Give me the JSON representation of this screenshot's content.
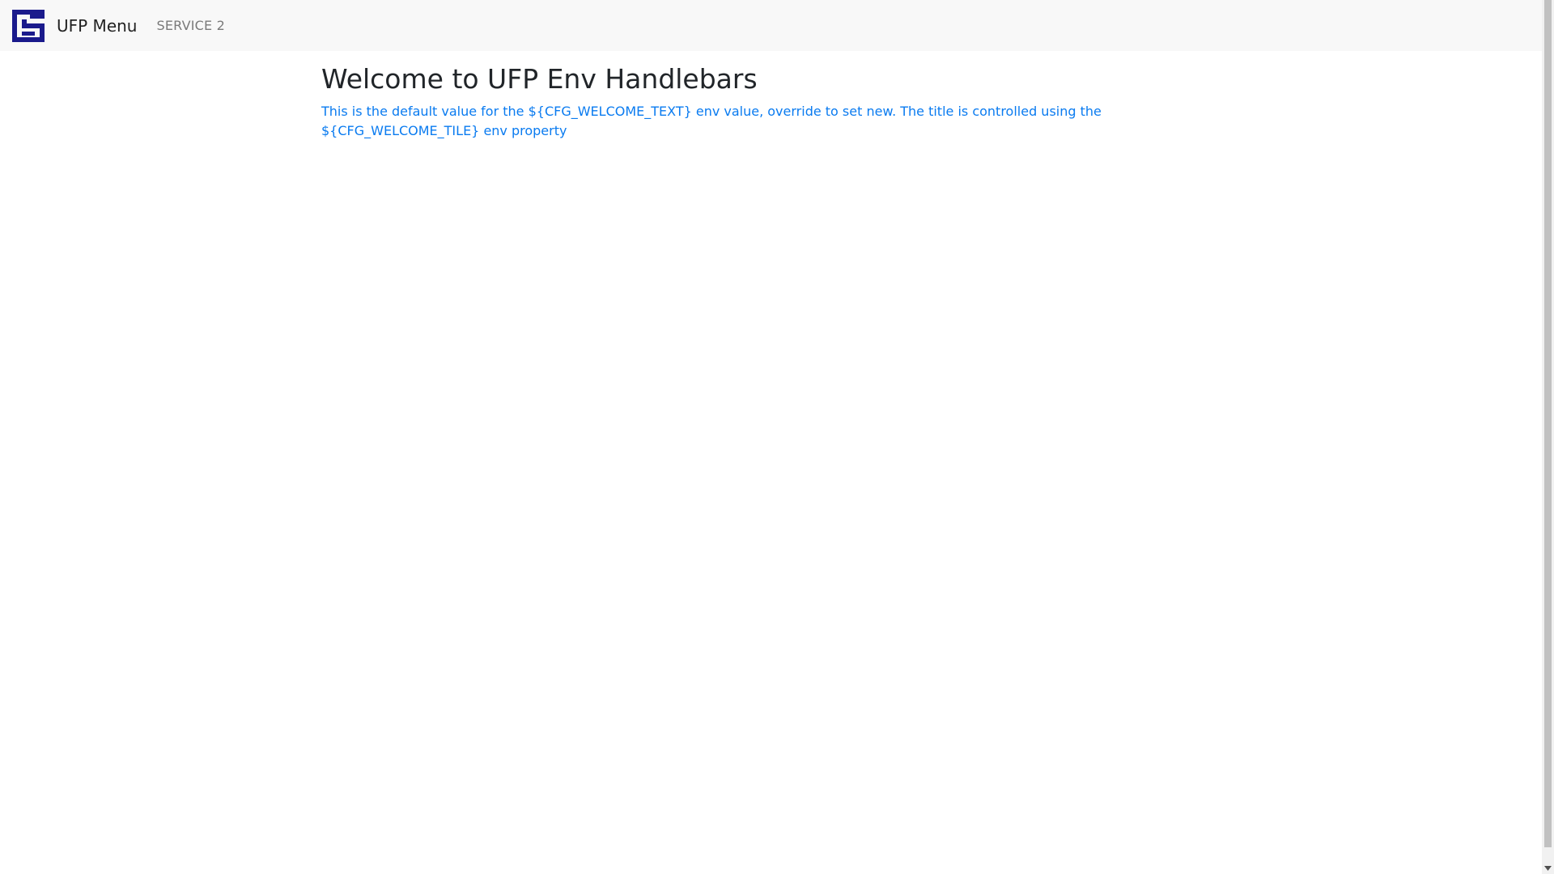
{
  "navbar": {
    "logo_icon": "ufp-logo-icon",
    "brand_label": "UFP Menu",
    "links": [
      {
        "label": "SERVICE 2"
      }
    ]
  },
  "main": {
    "title": "Welcome to UFP Env Handlebars",
    "welcome_text": "This is the default value for the ${CFG_WELCOME_TEXT} env value, override to set new. The title is controlled using the ${CFG_WELCOME_TILE} env property"
  },
  "colors": {
    "navbar_bg": "#f8f8f8",
    "logo_blue": "#1a1a8c",
    "link_text": "#7a7a7a",
    "welcome_text": "#0a7bf0"
  }
}
